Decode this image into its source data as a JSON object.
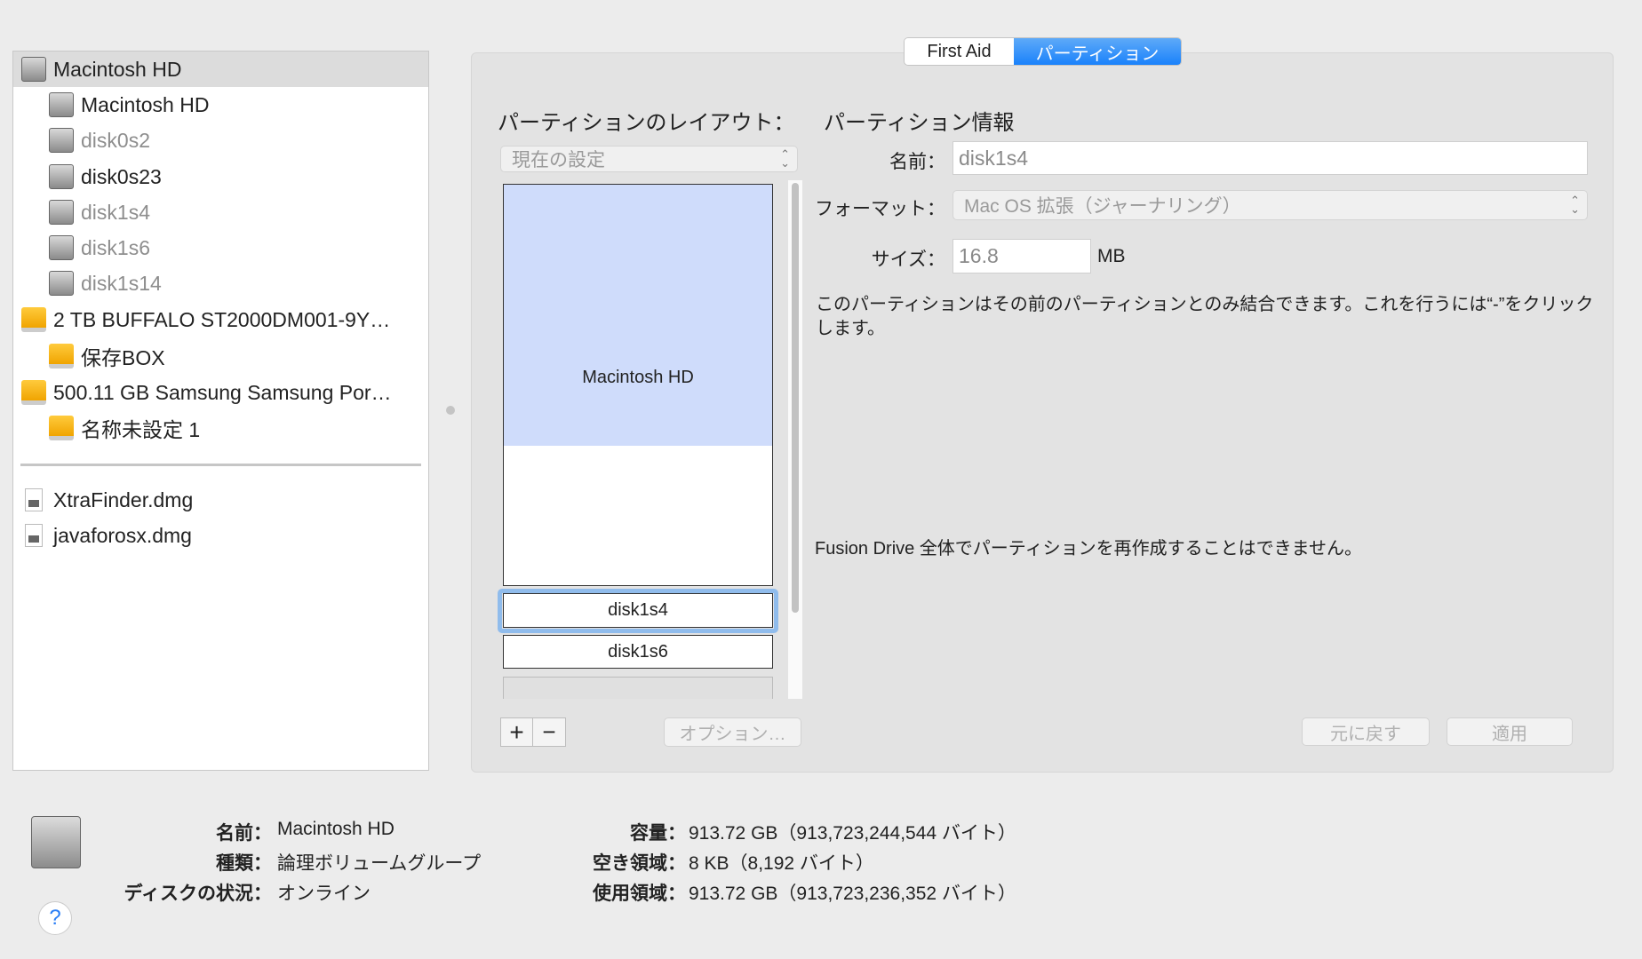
{
  "sidebar": {
    "items": [
      {
        "label": "Macintosh HD",
        "type": "hd",
        "level": 0,
        "dim": false,
        "selected": true
      },
      {
        "label": "Macintosh HD",
        "type": "hd",
        "level": 1,
        "dim": false
      },
      {
        "label": "disk0s2",
        "type": "hd",
        "level": 1,
        "dim": true
      },
      {
        "label": "disk0s23",
        "type": "hd",
        "level": 1,
        "dim": false
      },
      {
        "label": "disk1s4",
        "type": "hd",
        "level": 1,
        "dim": true
      },
      {
        "label": "disk1s6",
        "type": "hd",
        "level": 1,
        "dim": true
      },
      {
        "label": "disk1s14",
        "type": "hd",
        "level": 1,
        "dim": true
      },
      {
        "label": "2 TB BUFFALO ST2000DM001-9Y…",
        "type": "ext",
        "level": 0,
        "dim": false
      },
      {
        "label": "保存BOX",
        "type": "ext",
        "level": 1,
        "dim": false
      },
      {
        "label": "500.11 GB Samsung Samsung Por…",
        "type": "ext",
        "level": 0,
        "dim": false
      },
      {
        "label": "名称未設定 1",
        "type": "ext",
        "level": 1,
        "dim": false
      }
    ],
    "images": [
      {
        "label": "XtraFinder.dmg"
      },
      {
        "label": "javaforosx.dmg"
      }
    ]
  },
  "tabs": [
    "First Aid",
    "パーティション"
  ],
  "layout": {
    "heading": "パーティションのレイアウト：",
    "scheme": "現在の設定",
    "partitions": {
      "main": "Macintosh HD",
      "selected": "disk1s4",
      "next": "disk1s6"
    },
    "add": "+",
    "remove": "−",
    "options": "オプション…"
  },
  "info": {
    "heading": "パーティション情報",
    "name_label": "名前：",
    "name_value": "disk1s4",
    "format_label": "フォーマット：",
    "format_value": "Mac OS 拡張（ジャーナリング）",
    "size_label": "サイズ：",
    "size_value": "16.8",
    "size_unit": "MB",
    "note": "このパーティションはその前のパーティションとのみ結合できます。これを行うには“-”をクリックします。",
    "fusion_note": "Fusion Drive 全体でパーティションを再作成することはできません。",
    "revert": "元に戻す",
    "apply": "適用"
  },
  "bottom": {
    "name_label": "名前：",
    "name": "Macintosh HD",
    "type_label": "種類：",
    "type": "論理ボリュームグループ",
    "status_label": "ディスクの状況：",
    "status": "オンライン",
    "capacity_label": "容量：",
    "capacity": "913.72 GB（913,723,244,544 バイト）",
    "free_label": "空き領域：",
    "free": "8 KB（8,192 バイト）",
    "used_label": "使用領域：",
    "used": "913.72 GB（913,723,236,352 バイト）",
    "help": "?"
  }
}
